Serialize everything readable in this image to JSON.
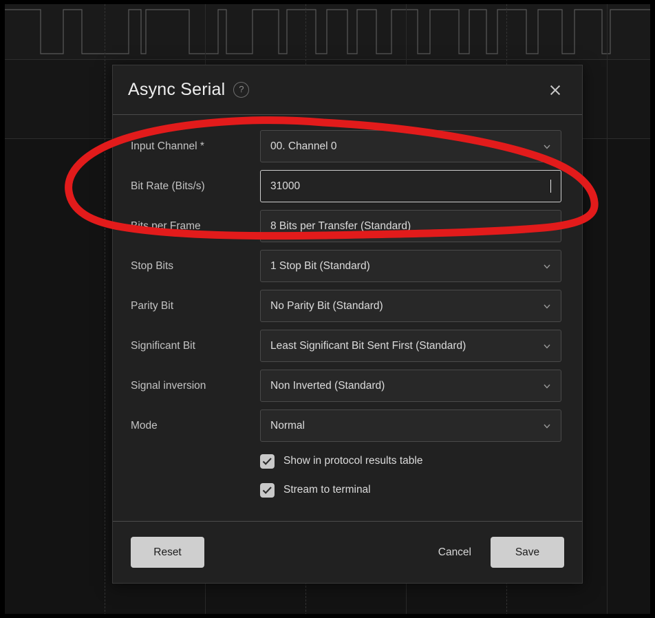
{
  "dialog": {
    "title": "Async Serial",
    "help_icon_glyph": "?",
    "close_icon": "close-icon",
    "fields": [
      {
        "label": "Input Channel *",
        "value": "00.  Channel 0",
        "type": "select"
      },
      {
        "label": "Bit Rate (Bits/s)",
        "value": "31000",
        "type": "text",
        "focused": true
      },
      {
        "label": "Bits per Frame",
        "value": "8 Bits per Transfer (Standard)",
        "type": "select"
      },
      {
        "label": "Stop Bits",
        "value": "1 Stop Bit (Standard)",
        "type": "select"
      },
      {
        "label": "Parity Bit",
        "value": "No Parity Bit (Standard)",
        "type": "select"
      },
      {
        "label": "Significant Bit",
        "value": "Least Significant Bit Sent First (Standard)",
        "type": "select"
      },
      {
        "label": "Signal inversion",
        "value": "Non Inverted (Standard)",
        "type": "select"
      },
      {
        "label": "Mode",
        "value": "Normal",
        "type": "select"
      }
    ],
    "checkboxes": [
      {
        "label": "Show in protocol results table",
        "checked": true
      },
      {
        "label": "Stream to terminal",
        "checked": true
      }
    ],
    "footer": {
      "reset_label": "Reset",
      "cancel_label": "Cancel",
      "save_label": "Save"
    }
  },
  "annotation": {
    "color": "#e21b1b",
    "shape": "hand-drawn-ellipse"
  },
  "background": {
    "kind": "logic-analyzer-waveform",
    "signal_color": "#5a5a5a"
  },
  "colors": {
    "dialog_bg": "#212121",
    "control_bg": "#282828",
    "label_text": "#c3c3c3",
    "value_text": "#dcdcdc",
    "button_solid_bg": "#cfcfcf",
    "annotation_red": "#e21b1b"
  }
}
